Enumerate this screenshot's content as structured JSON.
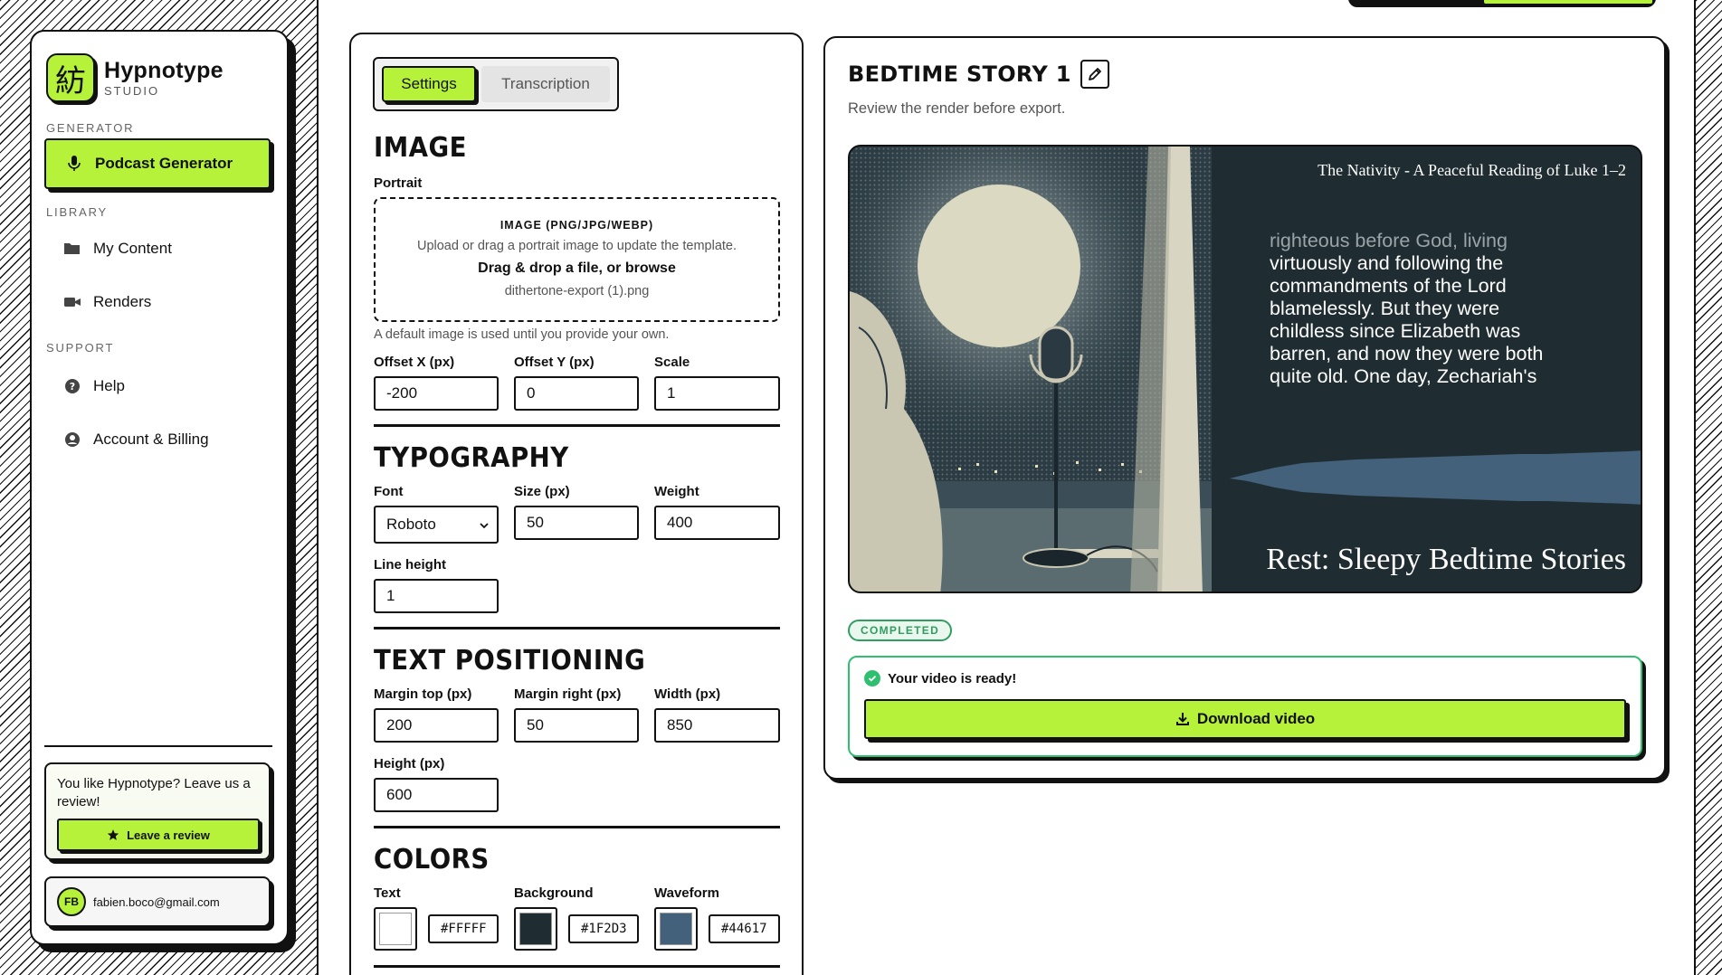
{
  "brand": {
    "logo_glyph": "紡",
    "name": "Hypnotype",
    "sub": "STUDIO"
  },
  "sidebar": {
    "generator_label": "GENERATOR",
    "active_item": "Podcast Generator",
    "library_label": "LIBRARY",
    "library_items": [
      "My Content",
      "Renders"
    ],
    "support_label": "SUPPORT",
    "support_items": [
      "Help",
      "Account & Billing"
    ],
    "review_text": "You like Hypnotype? Leave us a review!",
    "review_button": "Leave a review",
    "user_initials": "FB",
    "user_email": "fabien.boco@gmail.com"
  },
  "tabs": {
    "settings": "Settings",
    "transcription": "Transcription"
  },
  "image": {
    "heading": "IMAGE",
    "portrait_label": "Portrait",
    "dz_title": "IMAGE (PNG/JPG/WEBP)",
    "dz_desc": "Upload or drag a portrait image to update the template.",
    "dz_action": "Drag & drop a file, or browse",
    "dz_file": "dithertone-export (1).png",
    "hint": "A default image is used until you provide your own.",
    "offset_x_label": "Offset X (px)",
    "offset_x": "-200",
    "offset_y_label": "Offset Y (px)",
    "offset_y": "0",
    "scale_label": "Scale",
    "scale": "1"
  },
  "typography": {
    "heading": "TYPOGRAPHY",
    "font_label": "Font",
    "font": "Roboto",
    "size_label": "Size (px)",
    "size": "50",
    "weight_label": "Weight",
    "weight": "400",
    "line_height_label": "Line height",
    "line_height": "1"
  },
  "positioning": {
    "heading": "TEXT POSITIONING",
    "margin_top_label": "Margin top (px)",
    "margin_top": "200",
    "margin_right_label": "Margin right (px)",
    "margin_right": "50",
    "width_label": "Width (px)",
    "width": "850",
    "height_label": "Height (px)",
    "height": "600"
  },
  "colors": {
    "heading": "COLORS",
    "text_label": "Text",
    "text_hex": "#FFFFF",
    "text_color": "#ffffff",
    "bg_label": "Background",
    "bg_hex": "#1F2D3",
    "bg_color": "#1f2d33",
    "wave_label": "Waveform",
    "wave_hex": "#44617",
    "wave_color": "#44617b"
  },
  "preview": {
    "title": "BEDTIME STORY 1",
    "subtitle": "Review the render before export.",
    "episode_title": "The Nativity - A Peaceful Reading of Luke 1–2",
    "transcript_fade": "righteous before God, living",
    "transcript_lines": [
      "virtuously and following the",
      "commandments of the Lord",
      "blamelessly. But they were",
      "childless since Elizabeth was",
      "barren, and now they were both",
      "quite old. One day, Zechariah's"
    ],
    "show_name": "Rest: Sleepy Bedtime Stories",
    "status": "COMPLETED",
    "ready_text": "Your video is ready!",
    "download": "Download video"
  },
  "colors_ui": {
    "accent": "#b6f23a",
    "success": "#2fbf71",
    "ink": "#111111"
  }
}
